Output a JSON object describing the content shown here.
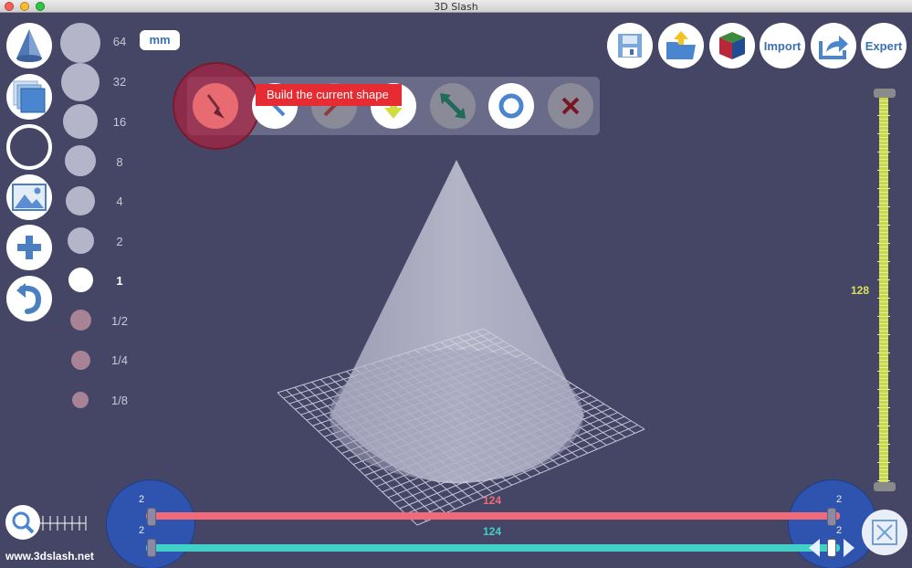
{
  "window": {
    "title": "3D Slash"
  },
  "colors": {
    "background": "#454566",
    "accent_blue": "#3a6fb0",
    "red_axis": "#f06a7a",
    "cyan_axis": "#41d0c8",
    "yellow_axis": "#c9d84a",
    "tooltip": "#e62b32"
  },
  "left_toolbar": {
    "icons": [
      "cone-icon",
      "layers-icon",
      "ring-icon",
      "image-icon",
      "plus-icon",
      "undo-icon"
    ]
  },
  "size_scale": {
    "labels": [
      "64",
      "32",
      "16",
      "8",
      "4",
      "2",
      "1",
      "1/2",
      "1/4",
      "1/8"
    ],
    "selected": "1"
  },
  "unit": "mm",
  "top_right": {
    "import_label": "Import",
    "expert_label": "Expert"
  },
  "tools": {
    "tooltip": "Build the current shape"
  },
  "rulers": {
    "vertical_value": "128",
    "red_value": "124",
    "cyan_value": "124",
    "left_top": "2",
    "left_bottom": "2",
    "right_top": "2",
    "right_bottom": "2"
  },
  "footer": {
    "url": "www.3dslash.net"
  }
}
